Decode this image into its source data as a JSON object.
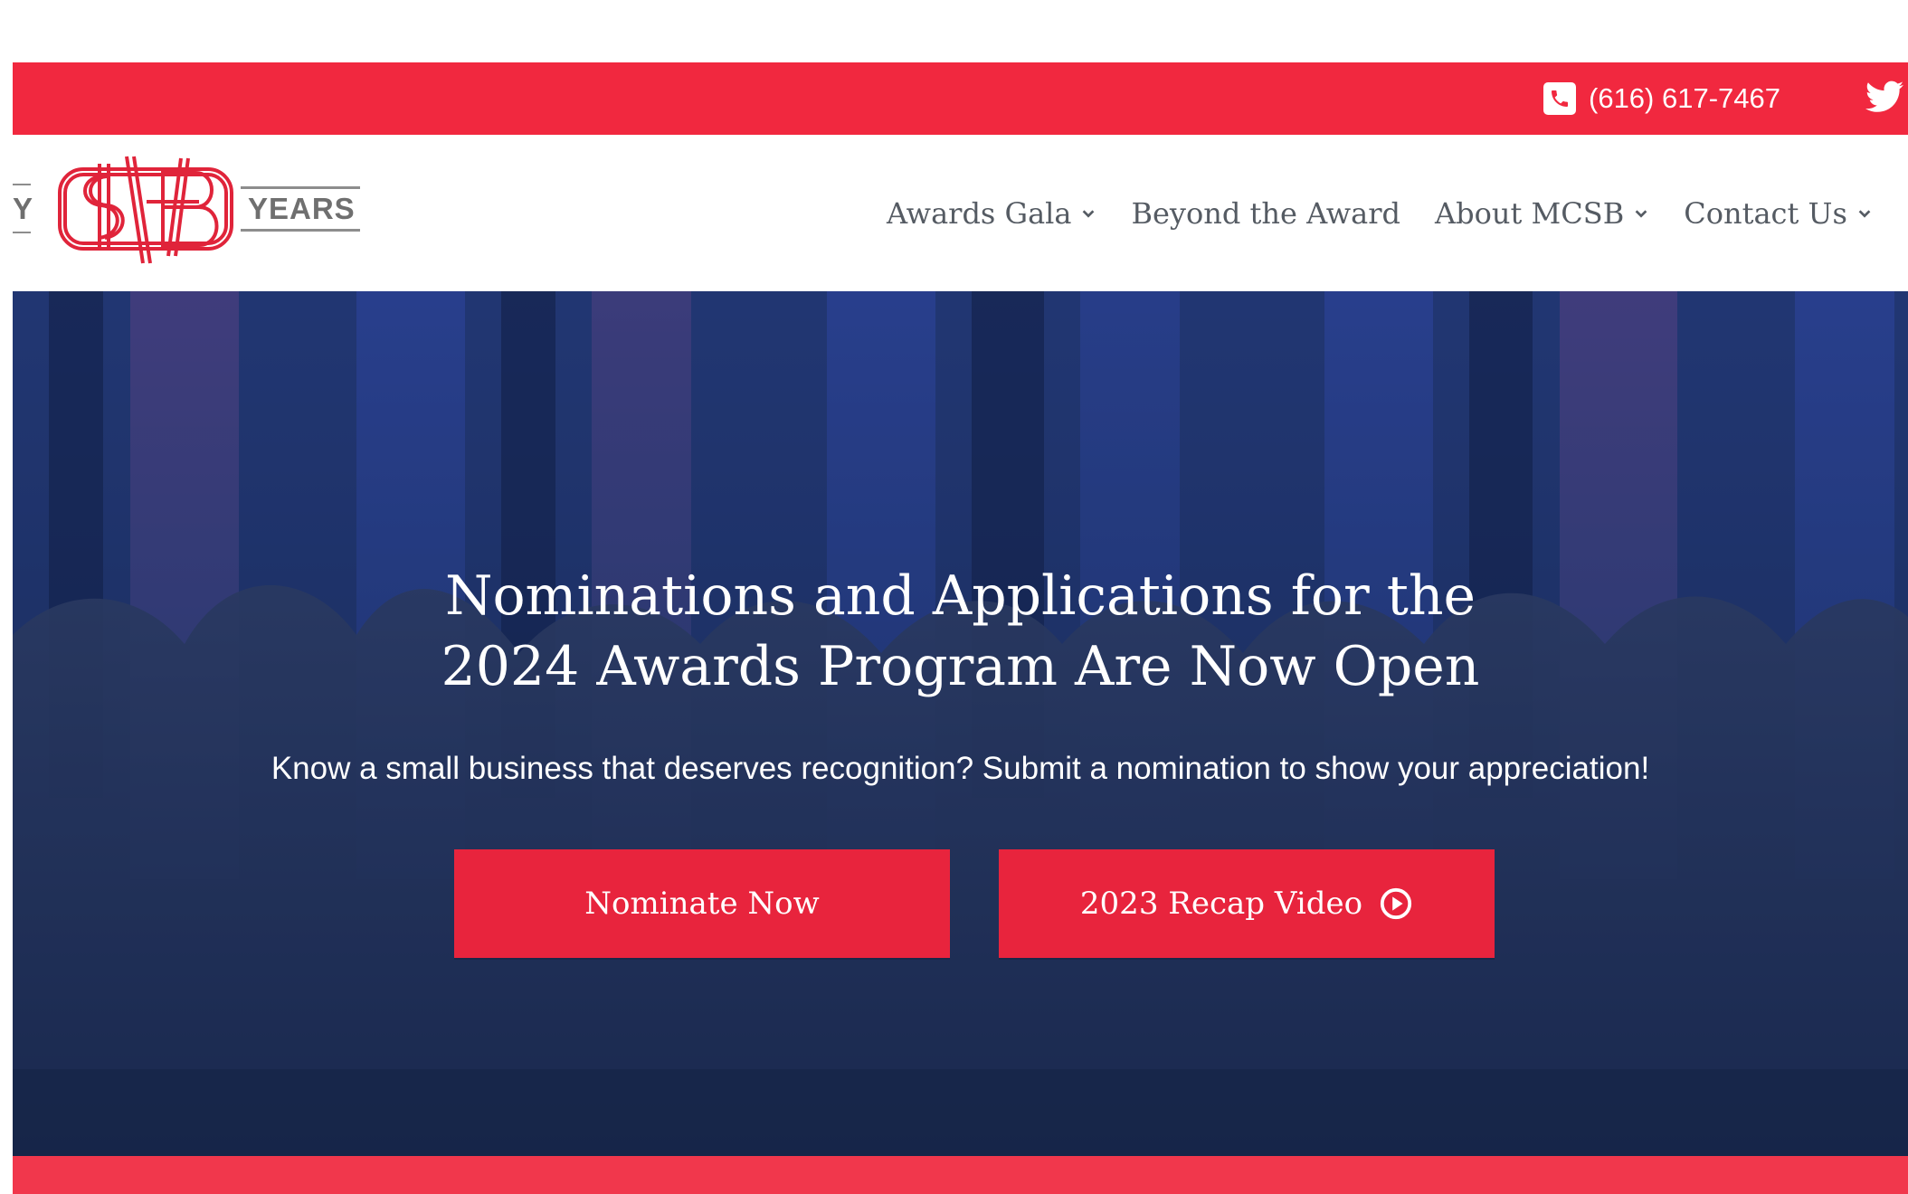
{
  "topbar": {
    "phone": "(616) 617-7467",
    "icons": [
      "phone-icon",
      "twitter-icon"
    ]
  },
  "logo": {
    "left_text": "Y",
    "right_text": "YEARS",
    "mark_icon": "mcsb-monogram-logo"
  },
  "nav": {
    "items": [
      {
        "label": "Awards Gala",
        "dropdown": true
      },
      {
        "label": "Beyond the Award",
        "dropdown": false
      },
      {
        "label": "About MCSB",
        "dropdown": true
      },
      {
        "label": "Contact Us",
        "dropdown": true
      }
    ]
  },
  "hero": {
    "title_line1": "Nominations and Applications for the",
    "title_line2": "2024 Awards Program Are Now Open",
    "subtitle": "Know a small business that deserves recognition? Submit a nomination to show your appreciation!",
    "primary_button": "Nominate Now",
    "secondary_button": "2023 Recap Video",
    "secondary_icon": "play-circle-icon"
  },
  "colors": {
    "brand_red": "#f1283f",
    "button_red": "#e8243d",
    "hero_blue": "#223a68",
    "nav_text": "#555b63"
  }
}
